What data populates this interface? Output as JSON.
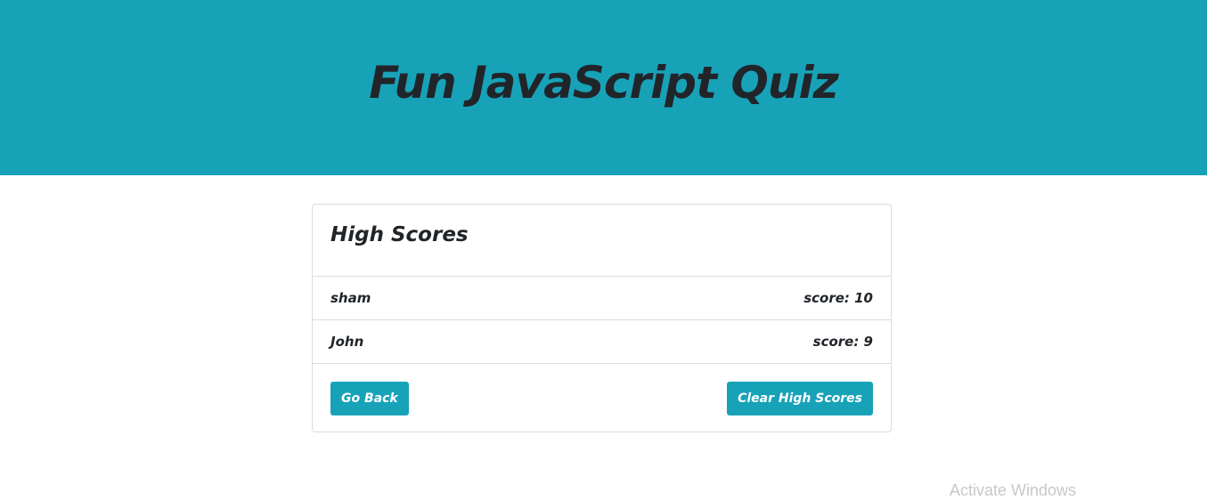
{
  "header": {
    "title": "Fun JavaScript Quiz",
    "background_color": "#17a2b8"
  },
  "scores_card": {
    "title": "High Scores",
    "rows": [
      {
        "name": "sham",
        "score": "score: 10"
      },
      {
        "name": "John",
        "score": "score: 9"
      }
    ],
    "go_back_label": "Go Back",
    "clear_label": "Clear High Scores",
    "button_color": "#17a2b8"
  },
  "overlay": {
    "watermark": "Activate Windows"
  }
}
